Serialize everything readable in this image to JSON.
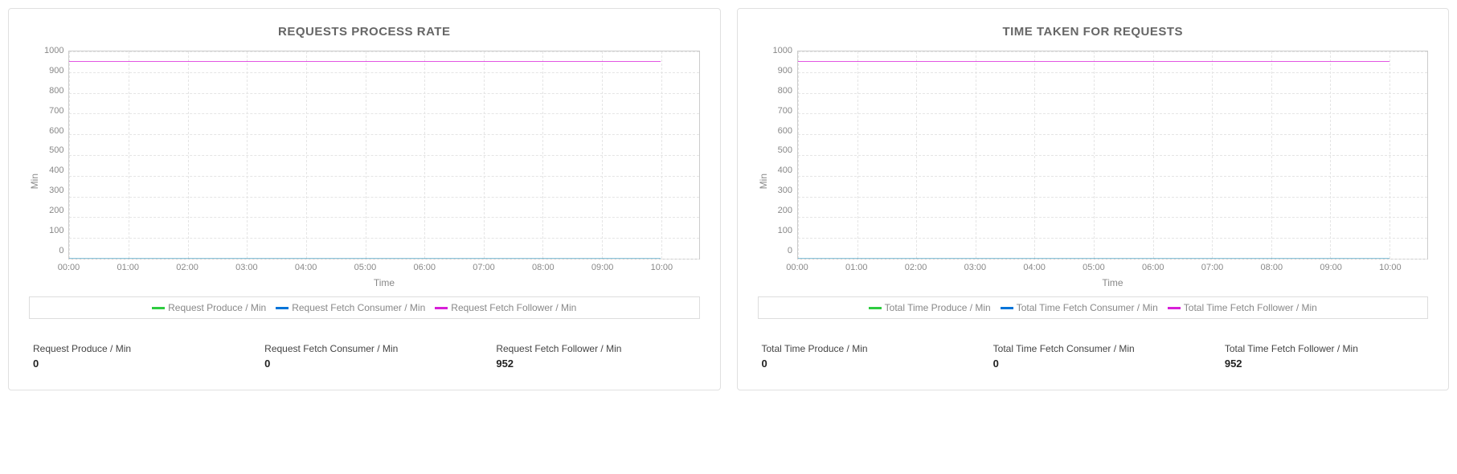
{
  "colors": {
    "green": "#2ecc40",
    "blue": "#0074d9",
    "magenta": "#d81fd8"
  },
  "panels": [
    {
      "title": "REQUESTS PROCESS RATE",
      "legend": [
        {
          "label": "Request Produce / Min",
          "color": "green"
        },
        {
          "label": "Request Fetch Consumer / Min",
          "color": "blue"
        },
        {
          "label": "Request Fetch Follower / Min",
          "color": "magenta"
        }
      ],
      "stats": [
        {
          "label": "Request Produce / Min",
          "value": "0"
        },
        {
          "label": "Request Fetch Consumer / Min",
          "value": "0"
        },
        {
          "label": "Request Fetch Follower / Min",
          "value": "952"
        }
      ]
    },
    {
      "title": "TIME TAKEN FOR REQUESTS",
      "legend": [
        {
          "label": "Total Time Produce / Min",
          "color": "green"
        },
        {
          "label": "Total Time Fetch Consumer / Min",
          "color": "blue"
        },
        {
          "label": "Total Time Fetch Follower / Min",
          "color": "magenta"
        }
      ],
      "stats": [
        {
          "label": "Total Time Produce / Min",
          "value": "0"
        },
        {
          "label": "Total Time Fetch Consumer / Min",
          "value": "0"
        },
        {
          "label": "Total Time Fetch Follower / Min",
          "value": "952"
        }
      ]
    }
  ],
  "axis": {
    "ylabel": "Min",
    "xlabel": "Time",
    "y_ticks": [
      "1000",
      "900",
      "800",
      "700",
      "600",
      "500",
      "400",
      "300",
      "200",
      "100",
      "0"
    ],
    "x_ticks": [
      "00:00",
      "01:00",
      "02:00",
      "03:00",
      "04:00",
      "05:00",
      "06:00",
      "07:00",
      "08:00",
      "09:00",
      "10:00"
    ]
  },
  "chart_data": [
    {
      "type": "line",
      "title": "REQUESTS PROCESS RATE",
      "xlabel": "Time",
      "ylabel": "Min",
      "ylim": [
        0,
        1000
      ],
      "categories": [
        "00:00",
        "01:00",
        "02:00",
        "03:00",
        "04:00",
        "05:00",
        "06:00",
        "07:00",
        "08:00",
        "09:00",
        "10:00"
      ],
      "series": [
        {
          "name": "Request Produce / Min",
          "values": [
            0,
            0,
            0,
            0,
            0,
            0,
            0,
            0,
            0,
            0,
            0
          ]
        },
        {
          "name": "Request Fetch Consumer / Min",
          "values": [
            0,
            0,
            0,
            0,
            0,
            0,
            0,
            0,
            0,
            0,
            0
          ]
        },
        {
          "name": "Request Fetch Follower / Min",
          "values": [
            952,
            952,
            952,
            952,
            952,
            952,
            952,
            952,
            952,
            952,
            952
          ]
        }
      ]
    },
    {
      "type": "line",
      "title": "TIME TAKEN FOR REQUESTS",
      "xlabel": "Time",
      "ylabel": "Min",
      "ylim": [
        0,
        1000
      ],
      "categories": [
        "00:00",
        "01:00",
        "02:00",
        "03:00",
        "04:00",
        "05:00",
        "06:00",
        "07:00",
        "08:00",
        "09:00",
        "10:00"
      ],
      "series": [
        {
          "name": "Total Time Produce / Min",
          "values": [
            0,
            0,
            0,
            0,
            0,
            0,
            0,
            0,
            0,
            0,
            0
          ]
        },
        {
          "name": "Total Time Fetch Consumer / Min",
          "values": [
            0,
            0,
            0,
            0,
            0,
            0,
            0,
            0,
            0,
            0,
            0
          ]
        },
        {
          "name": "Total Time Fetch Follower / Min",
          "values": [
            952,
            952,
            952,
            952,
            952,
            952,
            952,
            952,
            952,
            952,
            952
          ]
        }
      ]
    }
  ]
}
